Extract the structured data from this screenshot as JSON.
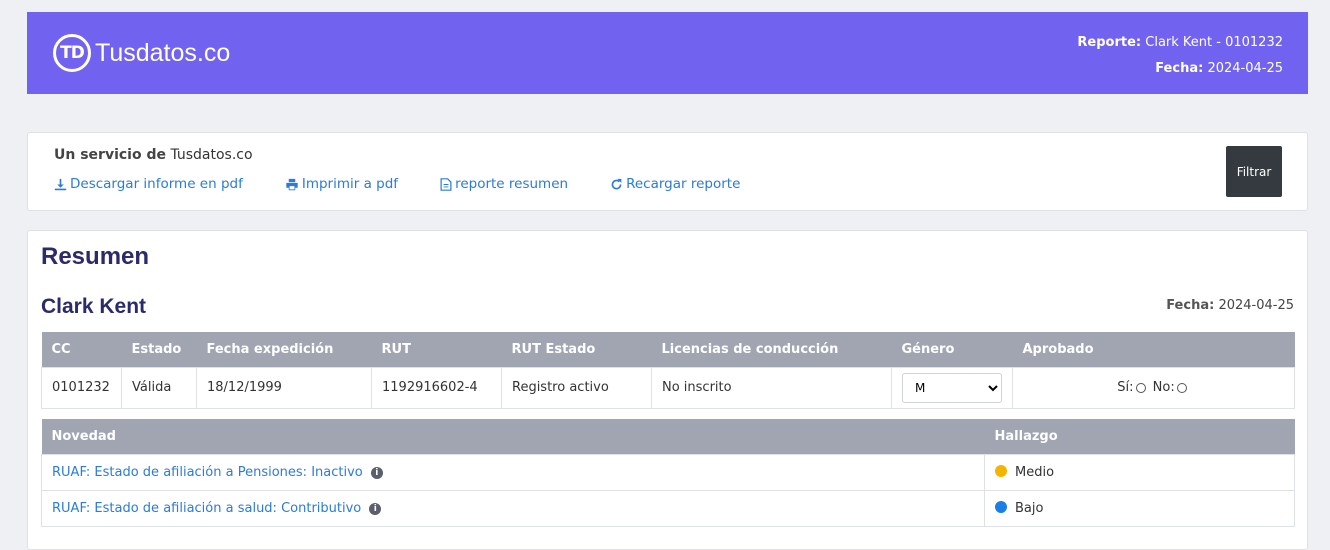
{
  "header": {
    "logo_mark": "TD",
    "logo_text": "Tusdatos.co",
    "reporte_label": "Reporte:",
    "reporte_value": "Clark Kent - 0101232",
    "fecha_label": "Fecha:",
    "fecha_value": "2024-04-25"
  },
  "service": {
    "prefix": "Un servicio de",
    "name": "Tusdatos.co",
    "links": [
      {
        "label": "Descargar informe en pdf",
        "icon": "download-icon"
      },
      {
        "label": "Imprimir a pdf",
        "icon": "print-icon"
      },
      {
        "label": "reporte resumen",
        "icon": "file-icon"
      },
      {
        "label": "Recargar reporte",
        "icon": "refresh-icon"
      }
    ],
    "filter_button": "Filtrar"
  },
  "summary": {
    "title": "Resumen",
    "person": "Clark Kent",
    "fecha_label": "Fecha:",
    "fecha_value": "2024-04-25",
    "table1": {
      "headers": [
        "CC",
        "Estado",
        "Fecha expedición",
        "RUT",
        "RUT Estado",
        "Licencias de conducción",
        "Género",
        "Aprobado"
      ],
      "row": {
        "cc": "0101232",
        "estado": "Válida",
        "fecha_expedicion": "18/12/1999",
        "rut": "1192916602-4",
        "rut_estado": "Registro activo",
        "licencias": "No inscrito",
        "genero": "M",
        "aprobado_si": "Sí:",
        "aprobado_no": "No:"
      }
    },
    "table2": {
      "headers": [
        "Novedad",
        "Hallazgo"
      ],
      "rows": [
        {
          "novedad": "RUAF: Estado de afiliación a Pensiones: Inactivo",
          "hallazgo": "Medio",
          "color": "#f5b400"
        },
        {
          "novedad": "RUAF: Estado de afiliación a salud: Contributivo",
          "hallazgo": "Bajo",
          "color": "#1a7ee6"
        }
      ]
    }
  }
}
